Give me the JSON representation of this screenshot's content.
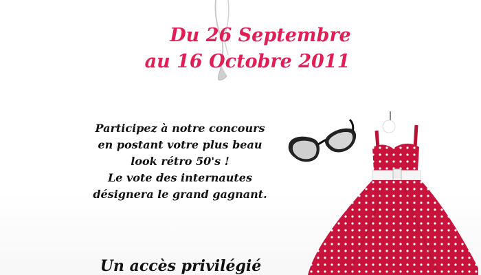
{
  "dates": {
    "line1": "Du 26 Septembre",
    "line2": "au 16 Octobre 2011"
  },
  "pitch": {
    "lines": [
      "Participez à notre concours",
      "en postant votre plus beau",
      "look rétro 50's !",
      "Le vote des internautes",
      "désignera le grand gagnant."
    ]
  },
  "access": {
    "text": "Un accès privilégié"
  },
  "colors": {
    "accent": "#e01f57",
    "dress_red": "#c8143c",
    "text": "#111111"
  },
  "icons": {
    "top_figure": "pin-up-silhouette-icon",
    "glasses": "cat-eye-sunglasses-icon",
    "dress": "polka-dot-dress-icon"
  }
}
